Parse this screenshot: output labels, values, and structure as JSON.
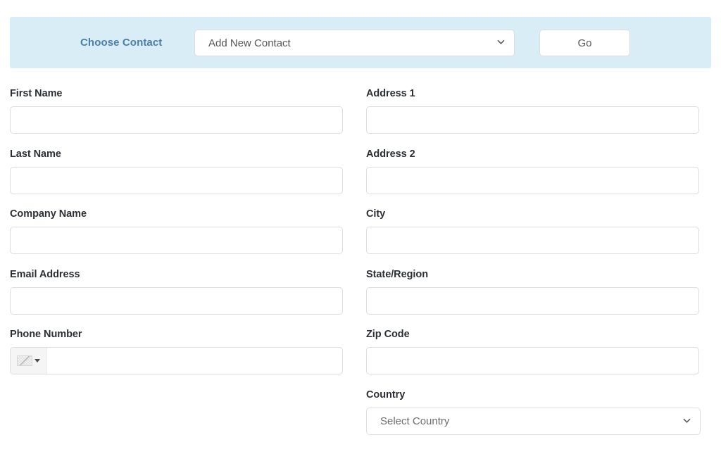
{
  "chooser": {
    "label": "Choose Contact",
    "select_value": "Add New Contact",
    "select_options": [
      "Add New Contact"
    ],
    "go_label": "Go",
    "band_color": "#d9edf7",
    "label_color": "#4a7fa8"
  },
  "form": {
    "left_column": [
      {
        "label": "First Name",
        "value": "",
        "placeholder": "",
        "type": "text"
      },
      {
        "label": "Last Name",
        "value": "",
        "placeholder": "",
        "type": "text"
      },
      {
        "label": "Company Name",
        "value": "",
        "placeholder": "",
        "type": "text"
      },
      {
        "label": "Email Address",
        "value": "",
        "placeholder": "",
        "type": "text"
      },
      {
        "label": "Phone Number",
        "value": "",
        "placeholder": "",
        "type": "phone"
      }
    ],
    "right_column": [
      {
        "label": "Address 1",
        "value": "",
        "placeholder": "",
        "type": "text"
      },
      {
        "label": "Address 2",
        "value": "",
        "placeholder": "",
        "type": "text"
      },
      {
        "label": "City",
        "value": "",
        "placeholder": "",
        "type": "text"
      },
      {
        "label": "State/Region",
        "value": "",
        "placeholder": "",
        "type": "text"
      },
      {
        "label": "Zip Code",
        "value": "",
        "placeholder": "",
        "type": "text"
      },
      {
        "label": "Country",
        "value": "Select Country",
        "type": "select",
        "options": [
          "Select Country"
        ]
      }
    ]
  },
  "icons": {
    "chevron_down": "chevron-down-icon",
    "flag_placeholder": "broken-flag-image-icon",
    "flag_caret": "caret-down-icon"
  }
}
